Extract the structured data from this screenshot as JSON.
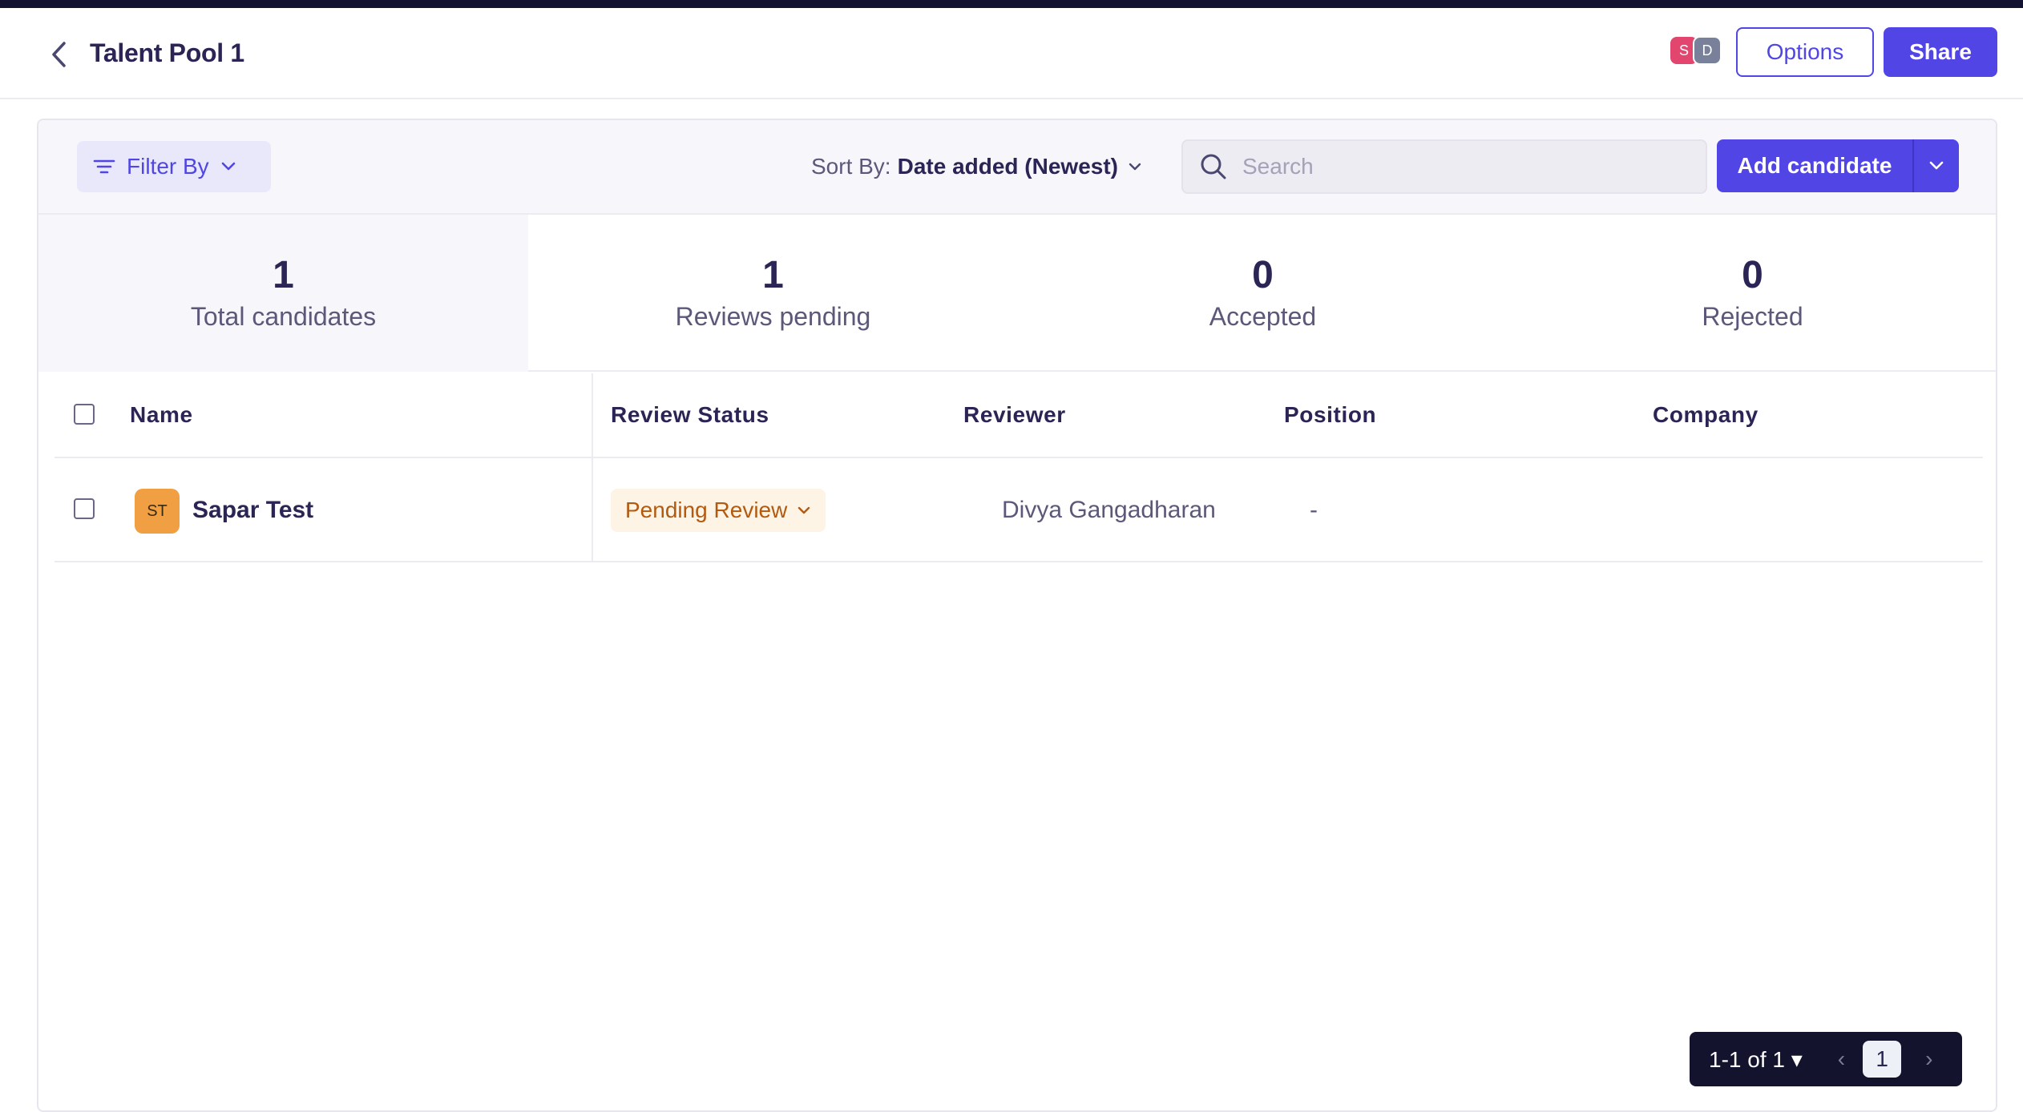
{
  "header": {
    "title": "Talent Pool 1",
    "collaborators": [
      "S",
      "D"
    ],
    "options_label": "Options",
    "share_label": "Share"
  },
  "toolbar": {
    "filter_label": "Filter By",
    "sort_label": "Sort By:",
    "sort_value": "Date added (Newest)",
    "search_placeholder": "Search",
    "add_label": "Add candidate"
  },
  "stats": [
    {
      "count": "1",
      "label": "Total candidates",
      "active": true
    },
    {
      "count": "1",
      "label": "Reviews pending",
      "active": false
    },
    {
      "count": "0",
      "label": "Accepted",
      "active": false
    },
    {
      "count": "0",
      "label": "Rejected",
      "active": false
    }
  ],
  "table": {
    "columns": [
      "Name",
      "Review Status",
      "Reviewer",
      "Position",
      "Company"
    ],
    "rows": [
      {
        "initials": "ST",
        "name": "Sapar Test",
        "review_status": "Pending Review",
        "reviewer": "Divya Gangadharan",
        "position": "-",
        "company": ""
      }
    ]
  },
  "pagination": {
    "range": "1-1 of 1 ▾",
    "current_page": "1"
  },
  "colors": {
    "accent": "#5145e6",
    "topbar": "#131230",
    "status_pending_bg": "#fdf4e6",
    "status_pending_text": "#b25a10",
    "avatar_s": "#e2466f",
    "avatar_d": "#79819a",
    "initials_bg": "#f0a042"
  }
}
